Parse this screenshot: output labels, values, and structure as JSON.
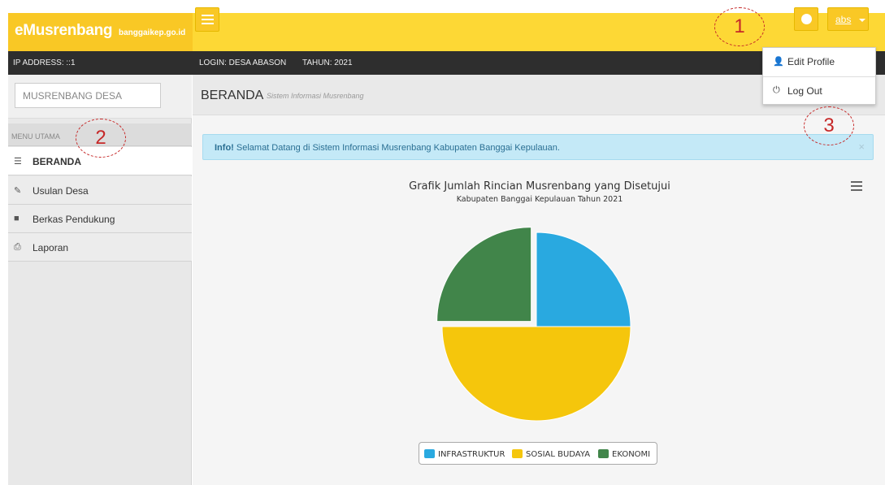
{
  "brand": {
    "name": "eMusrenbang",
    "domain": "banggaikep.go.id"
  },
  "header": {
    "user": "abs",
    "globe_icon": "globe-icon",
    "menu_icon": "hamburger-icon"
  },
  "infobar": {
    "ip": "IP ADDRESS: ::1",
    "login": "LOGIN: DESA ABASON",
    "tahun": "TAHUN: 2021"
  },
  "sidebar": {
    "context_label": "MUSRENBANG DESA",
    "menu_header": "MENU UTAMA",
    "items": [
      {
        "label": "BERANDA",
        "icon": "list-icon",
        "active": true
      },
      {
        "label": "Usulan Desa",
        "icon": "edit-icon",
        "active": false
      },
      {
        "label": "Berkas Pendukung",
        "icon": "book-icon",
        "active": false
      },
      {
        "label": "Laporan",
        "icon": "print-icon",
        "active": false
      }
    ]
  },
  "page": {
    "title": "BERANDA",
    "subtitle": "Sistem Informasi Musrenbang"
  },
  "alert": {
    "strong": "Info!",
    "text": " Selamat Datang di Sistem Informasi Musrenbang Kabupaten Banggai Kepulauan.",
    "close": "×"
  },
  "dropdown": {
    "items": [
      {
        "label": "Edit Profile",
        "icon": "user-icon"
      },
      {
        "label": "Log Out",
        "icon": "power-icon"
      }
    ]
  },
  "annotations": [
    "1",
    "2",
    "3"
  ],
  "colors": {
    "topbar": "#fdd835",
    "accent": "#f9c825",
    "annotation": "#c62828"
  },
  "chart_data": {
    "type": "pie",
    "title": "Grafik Jumlah Rincian Musrenbang yang Disetujui",
    "subtitle": "Kabupaten Banggai Kepulauan Tahun 2021",
    "categories": [
      "INFRASTRUKTUR",
      "SOSIAL BUDAYA",
      "EKONOMI"
    ],
    "values": [
      1,
      2,
      1
    ],
    "colors": [
      "#29a9e0",
      "#f5c60c",
      "#41854a"
    ],
    "sliced": [
      false,
      false,
      true
    ],
    "legend": "bottom-center"
  }
}
